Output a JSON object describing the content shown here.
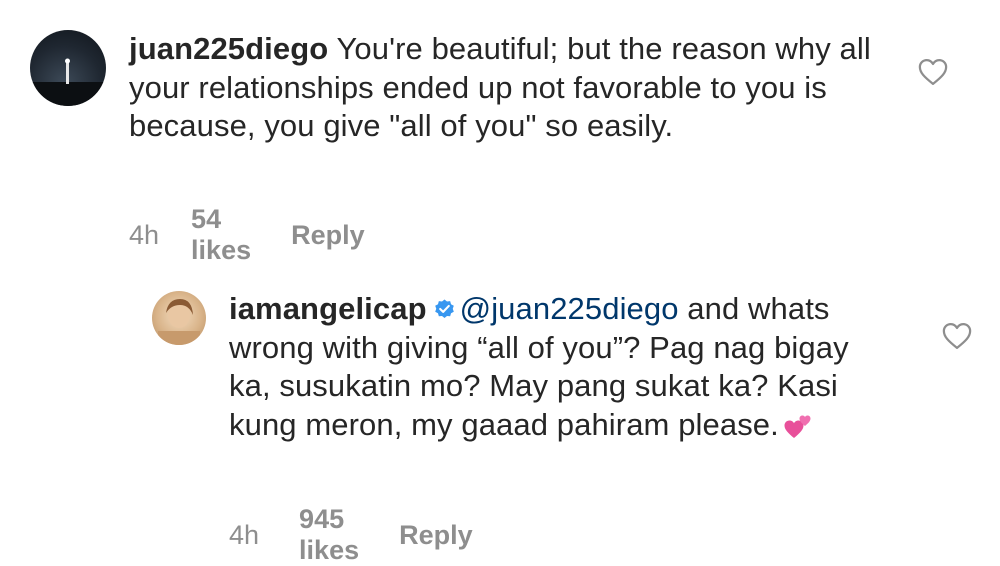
{
  "comments": [
    {
      "username": "juan225diego",
      "text": "You're beautiful; but the reason why all your relationships ended up not favorable to you is because, you give \"all of you\" so easily.",
      "time": "4h",
      "likes": "54 likes",
      "reply_label": "Reply"
    },
    {
      "username": "iamangelicap",
      "verified": true,
      "mention": "@juan225diego",
      "text": " and whats wrong with giving “all of you”? Pag nag bigay ka, susukatin mo? May pang sukat ka? Kasi kung meron, my gaaad pahiram please.",
      "emoji": "two-hearts-emoji",
      "time": "4h",
      "likes": "945 likes",
      "reply_label": "Reply"
    }
  ],
  "colors": {
    "text": "#262626",
    "secondary": "#8e8e8e",
    "mention": "#00376b",
    "verified": "#3897f0",
    "emoji_pink": "#e8509a"
  }
}
